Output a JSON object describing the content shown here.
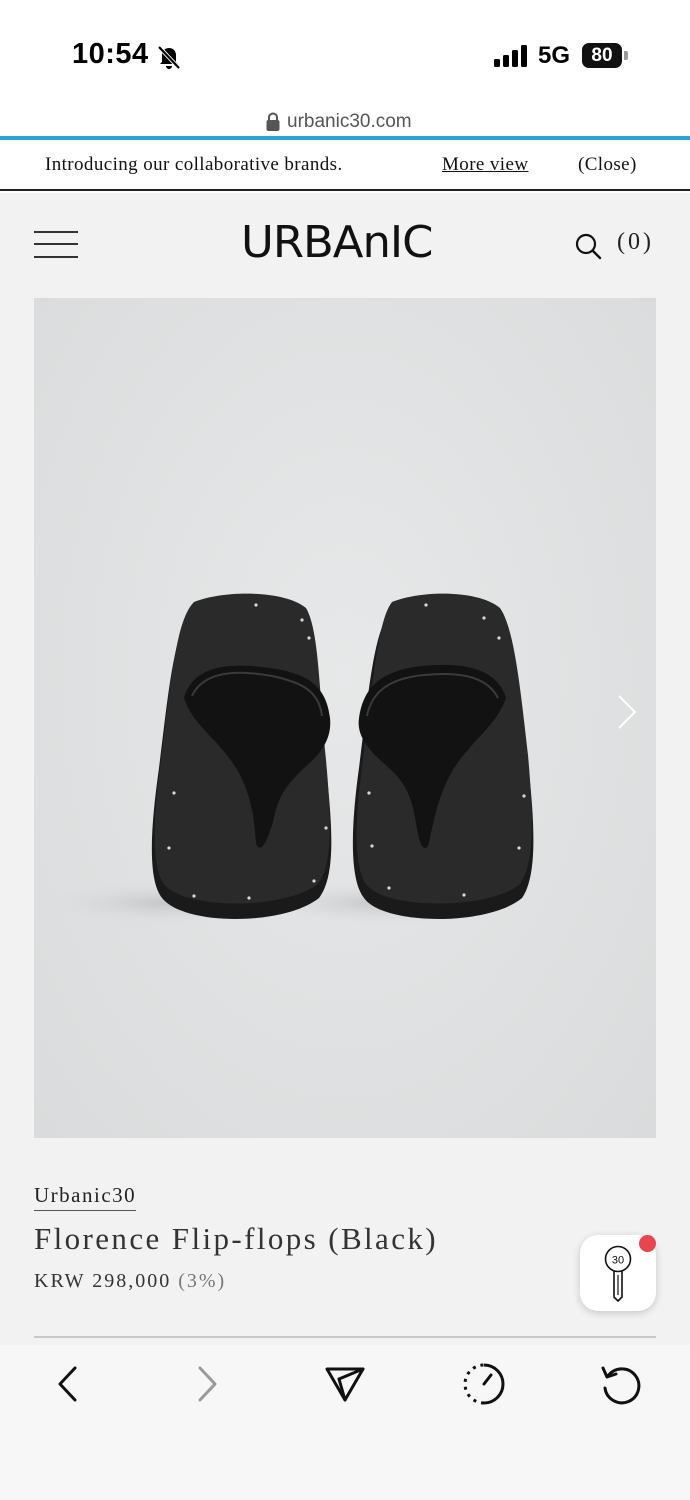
{
  "status_bar": {
    "time": "10:54",
    "network": "5G",
    "battery": "80",
    "icons": [
      "bell-slash-icon",
      "signal-bars-icon",
      "battery-icon"
    ]
  },
  "browser": {
    "url": "urbanic30.com"
  },
  "announcement": {
    "text": "Introducing our collaborative brands.",
    "more_label": "More view",
    "close_label": "(Close)"
  },
  "header": {
    "logo": "URBAnIC",
    "cart_count": "(0)",
    "icons": [
      "hamburger-menu-icon",
      "search-icon"
    ]
  },
  "product": {
    "image_alt": "black leather flip-flops",
    "brand": "Urbanic30",
    "name": "Florence Flip-flops (Black)",
    "price": "KRW 298,000",
    "discount": "(3%)",
    "floating_badge": "30"
  },
  "toolbar": {
    "icons": [
      "back-arrow-icon",
      "forward-arrow-icon",
      "share-icon",
      "history-icon",
      "reload-icon"
    ]
  },
  "colors": {
    "accent_line": "#2aa3d6",
    "notification_dot": "#e8454f",
    "page_background": "#f2f2f2"
  }
}
